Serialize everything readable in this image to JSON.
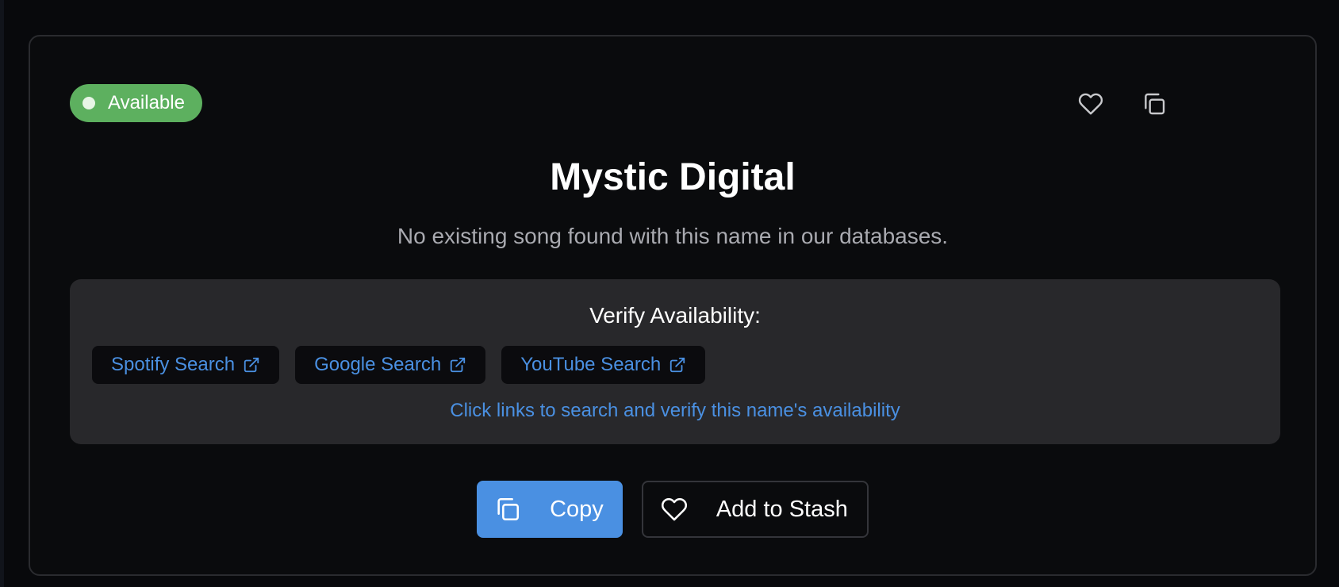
{
  "status_badge": {
    "label": "Available",
    "color": "#5db05f"
  },
  "header_icons": {
    "favorite": "heart-icon",
    "copy": "copy-icon"
  },
  "result": {
    "title": "Mystic Digital",
    "subtitle": "No existing song found with this name in our databases."
  },
  "verify": {
    "heading": "Verify Availability:",
    "links": [
      {
        "label": "Spotify Search",
        "icon": "external-link-icon"
      },
      {
        "label": "Google Search",
        "icon": "external-link-icon"
      },
      {
        "label": "YouTube Search",
        "icon": "external-link-icon"
      }
    ],
    "hint": "Click links to search and verify this name's availability"
  },
  "actions": {
    "copy_label": "Copy",
    "stash_label": "Add to Stash"
  },
  "colors": {
    "accent": "#4a90e2",
    "panel": "#28282b",
    "background": "#0a0b0d"
  }
}
